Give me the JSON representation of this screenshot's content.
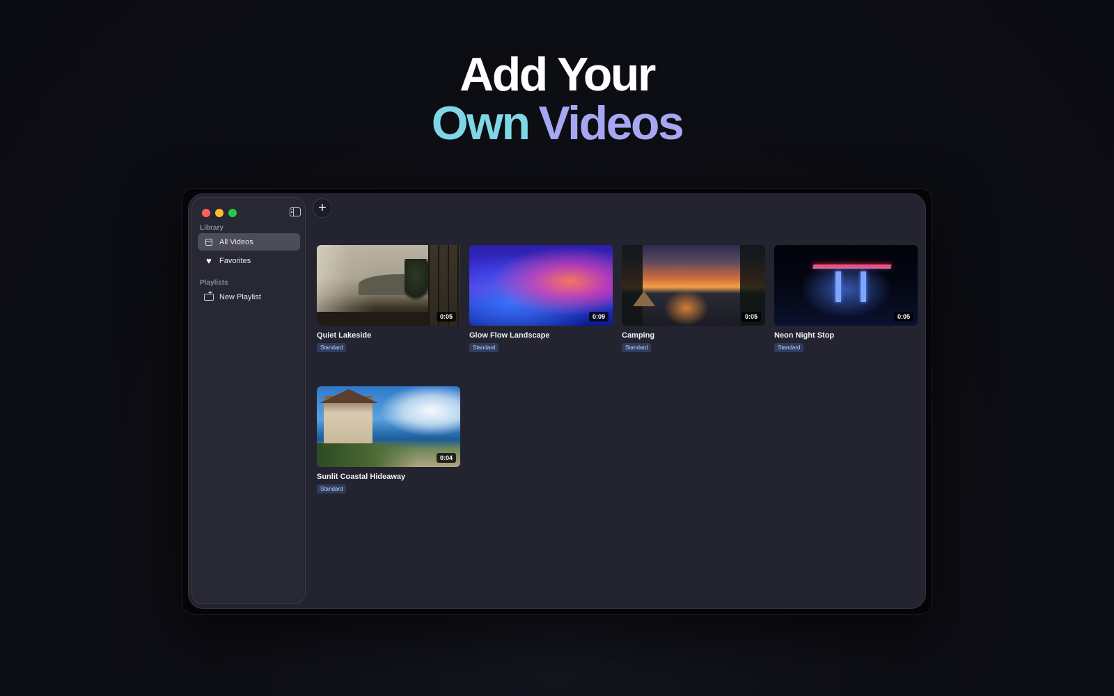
{
  "hero": {
    "line1": "Add Your",
    "line2_word1": "Own",
    "line2_word2": "Videos"
  },
  "colors": {
    "own": "#7fd6e6",
    "videos": "#a6a6f2",
    "badge": "#2d3d5e"
  },
  "sidebar": {
    "library_label": "Library",
    "items": [
      {
        "label": "All Videos",
        "icon": "archive-icon",
        "active": true
      },
      {
        "label": "Favorites",
        "icon": "heart-icon",
        "active": false
      }
    ],
    "playlists_label": "Playlists",
    "new_playlist_label": "New Playlist"
  },
  "toolbar": {
    "add_label": "+"
  },
  "videos": [
    {
      "title": "Quiet Lakeside",
      "duration": "0:05",
      "badge": "Standard"
    },
    {
      "title": "Glow Flow Landscape",
      "duration": "0:09",
      "badge": "Standard"
    },
    {
      "title": "Camping",
      "duration": "0:05",
      "badge": "Standard"
    },
    {
      "title": "Neon Night Stop",
      "duration": "0:05",
      "badge": "Standard"
    },
    {
      "title": "Sunlit Coastal Hideaway",
      "duration": "0:04",
      "badge": "Standard"
    }
  ]
}
